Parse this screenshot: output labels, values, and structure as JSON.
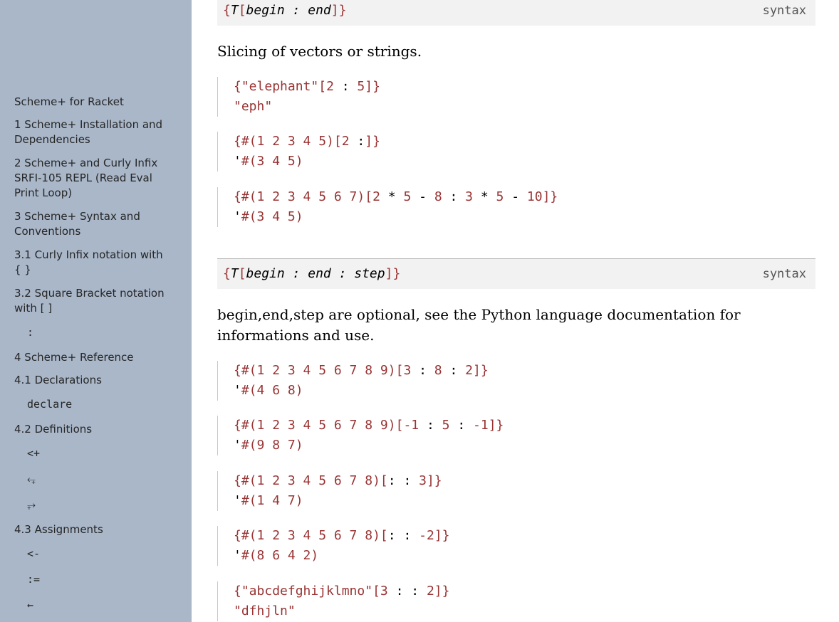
{
  "sidebar": {
    "title": "Scheme+ for Racket",
    "items": [
      {
        "label": "1  Scheme+ Installation and Dependencies"
      },
      {
        "label": "2  Scheme+ and Curly Infix SRFI-105 REPL (Read Eval Print Loop)"
      },
      {
        "label": "3  Scheme+ Syntax and Conventions"
      },
      {
        "label": "3.1  Curly Infix notation with { }"
      },
      {
        "label": "3.2  Square Bracket notation with [ ]"
      },
      {
        "label": ":"
      },
      {
        "label": "4  Scheme+ Reference"
      },
      {
        "label": "4.1  Declarations"
      },
      {
        "label": "declare"
      },
      {
        "label": "4.2  Definitions"
      },
      {
        "label": "<+"
      },
      {
        "label": "⥆"
      },
      {
        "label": "⥅"
      },
      {
        "label": "4.3  Assignments"
      },
      {
        "label": "<-"
      },
      {
        "label": ":="
      },
      {
        "label": "←"
      }
    ]
  },
  "syntax1": {
    "open": "{",
    "T": "T",
    "bracket_open": "[",
    "args": "begin : end",
    "bracket_close": "]",
    "close": "}",
    "kind": "syntax"
  },
  "prose1": "Slicing of vectors or strings.",
  "syntax2": {
    "open": "{",
    "T": "T",
    "bracket_open": "[",
    "args": "begin : end : step",
    "bracket_close": "]",
    "close": "}",
    "kind": "syntax"
  },
  "prose2": "begin,end,step are optional, see the Python language documentation for informations and use.",
  "examples": [
    {
      "input": "{\"elephant\"[2 : 5]}",
      "output": "\"eph\""
    },
    {
      "input": "{#(1 2 3 4 5)[2 :]}",
      "output": "'#(3 4 5)"
    },
    {
      "input": "{#(1 2 3 4 5 6 7)[2 * 5 - 8 : 3 * 5 - 10]}",
      "output": "'#(3 4 5)"
    },
    {
      "input": "{#(1 2 3 4 5 6 7 8 9)[3 : 8 : 2]}",
      "output": "'#(4 6 8)"
    },
    {
      "input": "{#(1 2 3 4 5 6 7 8 9)[-1 : 5 : -1]}",
      "output": "'#(9 8 7)"
    },
    {
      "input": "{#(1 2 3 4 5 6 7 8)[: : 3]}",
      "output": "'#(1 4 7)"
    },
    {
      "input": "{#(1 2 3 4 5 6 7 8)[: : -2]}",
      "output": "'#(8 6 4 2)"
    },
    {
      "input": "{\"abcdefghijklmno\"[3 : : 2]}",
      "output": "\"dfhjln\""
    }
  ],
  "colors": {
    "sidebar_bg": "#a9b7c9",
    "code_value": "#993333",
    "syntax_bg": "#f2f2f2"
  }
}
